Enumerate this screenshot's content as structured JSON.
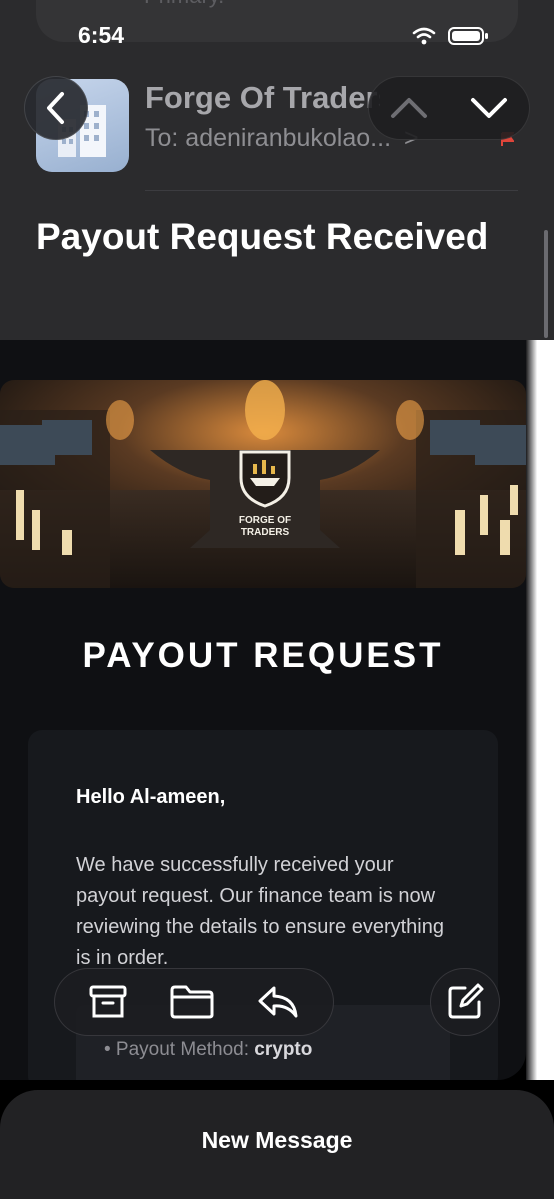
{
  "status": {
    "time": "6:54"
  },
  "previous_message": {
    "snippet": "Primary."
  },
  "header": {
    "sender": "Forge Of Traders",
    "recipient": "To: adeniranbukolao...",
    "recipient_chevron": ">",
    "subject": "Payout Request Received"
  },
  "email": {
    "logo_line1": "FORGE OF",
    "logo_line2": "TRADERS",
    "title": "PAYOUT REQUEST",
    "greeting": "Hello Al-ameen,",
    "body": "We have successfully received your payout request. Our finance team is now reviewing the details to ensure everything is in order.",
    "method_label": "• Payout Method:",
    "method_value": "crypto"
  },
  "toolbar": {
    "icons": [
      "archive-icon",
      "folder-icon",
      "reply-icon",
      "compose-icon"
    ]
  },
  "sheet": {
    "label": "New Message"
  },
  "colors": {
    "background": "#0f1013",
    "header": "#2b2b2d",
    "flag": "#e0453a"
  }
}
